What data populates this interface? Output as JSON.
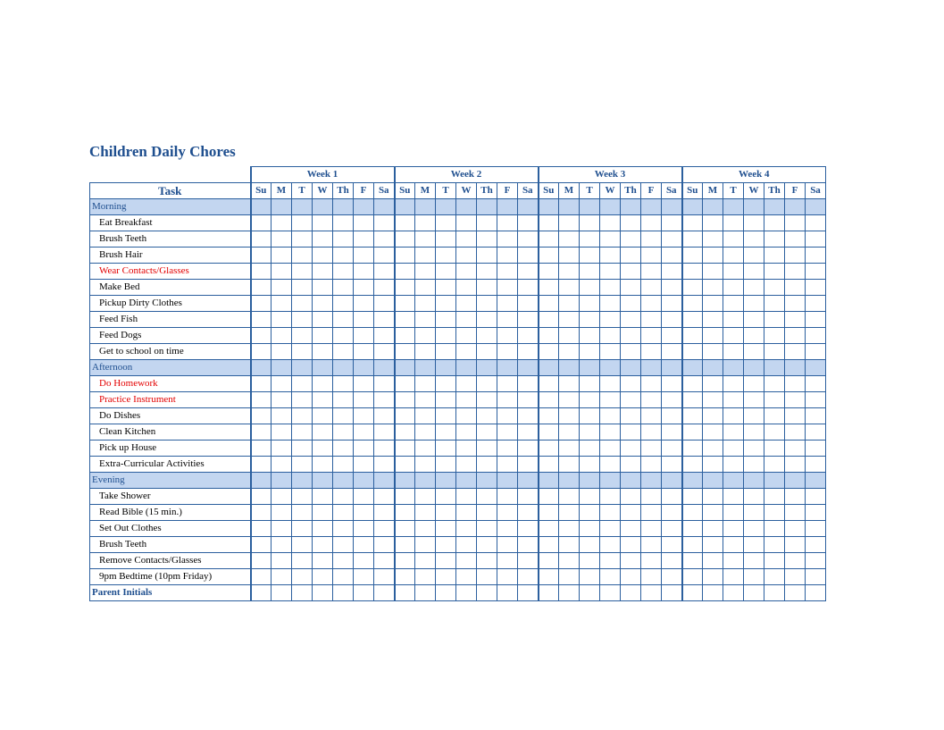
{
  "title": "Children Daily Chores",
  "taskHeader": "Task",
  "weeks": [
    "Week 1",
    "Week 2",
    "Week 3",
    "Week 4"
  ],
  "days": [
    "Su",
    "M",
    "T",
    "W",
    "Th",
    "F",
    "Sa"
  ],
  "footer": "Parent Initials",
  "sections": [
    {
      "name": "Morning",
      "tasks": [
        {
          "label": "Eat Breakfast",
          "highlight": false
        },
        {
          "label": "Brush Teeth",
          "highlight": false
        },
        {
          "label": "Brush Hair",
          "highlight": false
        },
        {
          "label": "Wear Contacts/Glasses",
          "highlight": true
        },
        {
          "label": "Make Bed",
          "highlight": false
        },
        {
          "label": "Pickup Dirty Clothes",
          "highlight": false
        },
        {
          "label": "Feed Fish",
          "highlight": false
        },
        {
          "label": "Feed Dogs",
          "highlight": false
        },
        {
          "label": "Get to school on time",
          "highlight": false
        }
      ]
    },
    {
      "name": "Afternoon",
      "tasks": [
        {
          "label": "Do Homework",
          "highlight": true
        },
        {
          "label": "Practice Instrument",
          "highlight": true
        },
        {
          "label": "Do Dishes",
          "highlight": false
        },
        {
          "label": "Clean Kitchen",
          "highlight": false
        },
        {
          "label": "Pick up House",
          "highlight": false
        },
        {
          "label": "Extra-Curricular Activities",
          "highlight": false
        }
      ]
    },
    {
      "name": "Evening",
      "tasks": [
        {
          "label": "Take Shower",
          "highlight": false
        },
        {
          "label": "Read Bible (15 min.)",
          "highlight": false
        },
        {
          "label": "Set Out Clothes",
          "highlight": false
        },
        {
          "label": "Brush Teeth",
          "highlight": false
        },
        {
          "label": "Remove Contacts/Glasses",
          "highlight": false
        },
        {
          "label": "9pm Bedtime (10pm Friday)",
          "highlight": false
        }
      ]
    }
  ]
}
